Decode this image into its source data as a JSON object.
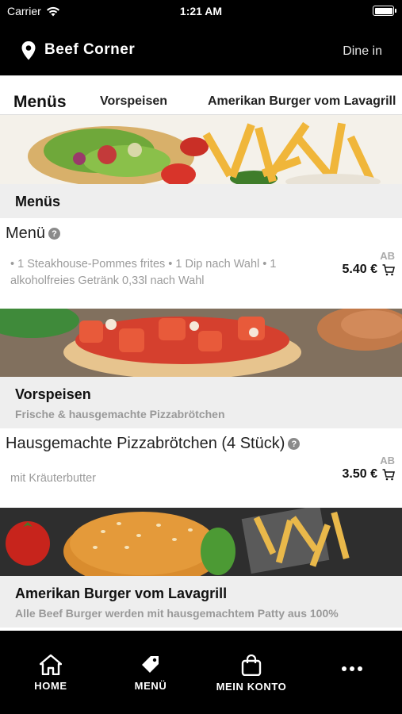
{
  "status_bar": {
    "carrier": "Carrier",
    "time": "1:21 AM"
  },
  "header": {
    "store_name": "Beef Corner",
    "mode": "Dine in",
    "icon": "location-pin-icon"
  },
  "tabs": [
    {
      "label": "Menüs",
      "active": true
    },
    {
      "label": "Vorspeisen",
      "active": false
    },
    {
      "label": "Amerikan Burger vom Lavagrill",
      "active": false
    }
  ],
  "sections": [
    {
      "title": "Menüs",
      "subtitle": "",
      "items": [
        {
          "name": "Menü",
          "description": "• 1 Steakhouse-Pommes frites • 1 Dip nach Wahl • 1 alkoholfreies Getränk 0,33l nach Wahl",
          "price_prefix": "AB",
          "price": "5.40 €"
        }
      ]
    },
    {
      "title": "Vorspeisen",
      "subtitle": "Frische & hausgemachte Pizzabrötchen",
      "items": [
        {
          "name": "Hausgemachte Pizzabrötchen (4 Stück)",
          "description": "mit Kräuterbutter",
          "price_prefix": "AB",
          "price": "3.50 €"
        }
      ]
    },
    {
      "title": "Amerikan Burger vom Lavagrill",
      "subtitle": "Alle Beef Burger werden mit hausgemachtem Patty aus 100%"
    }
  ],
  "bottom_nav": [
    {
      "label": "HOME",
      "icon": "home-icon"
    },
    {
      "label": "MENÜ",
      "icon": "tag-icon"
    },
    {
      "label": "MEIN KONTO",
      "icon": "shopping-bag-icon"
    },
    {
      "label": "",
      "icon": "more-dots-icon"
    }
  ],
  "colors": {
    "bar_bg": "#000000",
    "section_bg": "#eeeeee",
    "muted_text": "#9b9b9b"
  }
}
